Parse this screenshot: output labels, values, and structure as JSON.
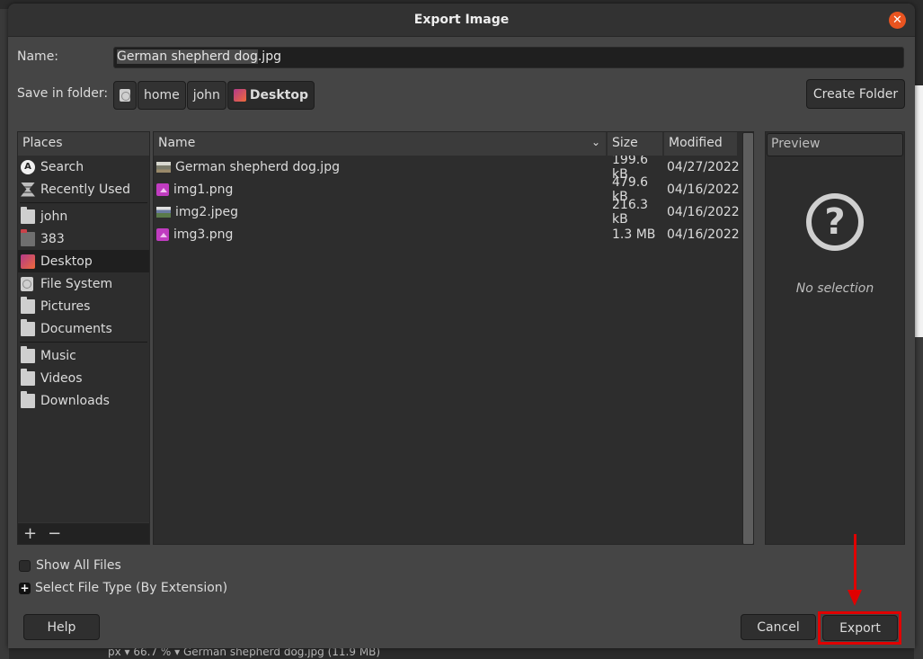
{
  "dialog": {
    "title": "Export Image",
    "close_icon": "close-icon"
  },
  "name_field": {
    "label": "Name:",
    "value_selected": "German shepherd dog",
    "value_rest": ".jpg"
  },
  "folder": {
    "label": "Save in folder:",
    "breadcrumbs": [
      {
        "label": "",
        "icon": "disk-icon"
      },
      {
        "label": "home"
      },
      {
        "label": "john"
      },
      {
        "label": "Desktop",
        "icon": "desktop-icon",
        "active": true
      }
    ],
    "create_folder_label": "Create Folder"
  },
  "places": {
    "header": "Places",
    "groups": [
      [
        {
          "label": "Search",
          "icon": "search-icon"
        },
        {
          "label": "Recently Used",
          "icon": "recent-icon"
        }
      ],
      [
        {
          "label": "john",
          "icon": "folder-icon"
        },
        {
          "label": "383",
          "icon": "folder-icon"
        },
        {
          "label": "Desktop",
          "icon": "desktop-icon",
          "active": true
        },
        {
          "label": "File System",
          "icon": "disk-icon"
        },
        {
          "label": "Pictures",
          "icon": "folder-icon"
        },
        {
          "label": "Documents",
          "icon": "folder-icon"
        }
      ],
      [
        {
          "label": "Music",
          "icon": "folder-icon"
        },
        {
          "label": "Videos",
          "icon": "folder-icon"
        },
        {
          "label": "Downloads",
          "icon": "folder-icon"
        }
      ]
    ],
    "add_label": "+",
    "remove_label": "−"
  },
  "files": {
    "columns": {
      "name": "Name",
      "size": "Size",
      "modified": "Modified"
    },
    "rows": [
      {
        "name": "German shepherd dog.jpg",
        "size": "199.6 kB",
        "modified": "04/27/2022",
        "icon": "photo-thumbnail"
      },
      {
        "name": "img1.png",
        "size": "479.6 kB",
        "modified": "04/16/2022",
        "icon": "image-file-icon"
      },
      {
        "name": "img2.jpeg",
        "size": "216.3 kB",
        "modified": "04/16/2022",
        "icon": "photo-thumbnail"
      },
      {
        "name": "img3.png",
        "size": "1.3 MB",
        "modified": "04/16/2022",
        "icon": "image-file-icon"
      }
    ]
  },
  "preview": {
    "header": "Preview",
    "empty_text": "No selection"
  },
  "options": {
    "show_all_files": "Show All Files",
    "show_all_files_checked": false,
    "select_file_type": "Select File Type (By Extension)"
  },
  "buttons": {
    "help": "Help",
    "cancel": "Cancel",
    "export": "Export"
  },
  "background": {
    "status_text": "px  ▾  66.7 %  ▾  German shepherd dog.jpg (11.9 MB)"
  },
  "colors": {
    "accent_close": "#e95420",
    "annotation_red": "#e00000"
  }
}
